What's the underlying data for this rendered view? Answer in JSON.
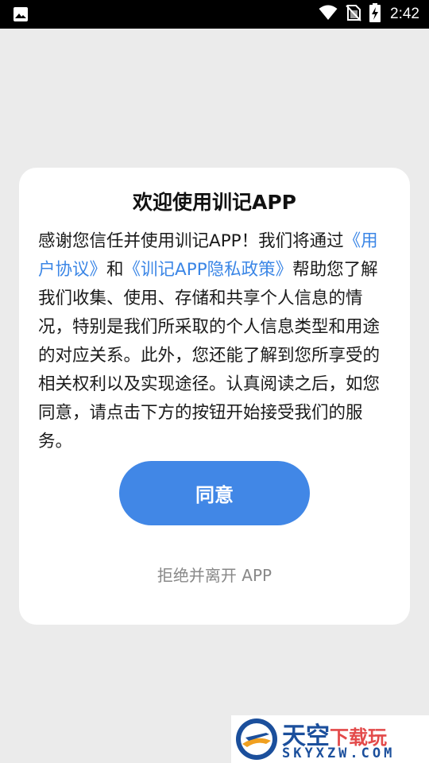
{
  "status_bar": {
    "time": "2:42",
    "icons": [
      "image-icon",
      "wifi-icon",
      "no-sim-icon",
      "battery-charging-icon"
    ]
  },
  "dialog": {
    "title": "欢迎使用训记APP",
    "body_text_1": "感谢您信任并使用训记APP！我们将通过",
    "link_user_agreement": "《用户协议》",
    "body_text_and": "和",
    "link_privacy_policy": "《训记APP隐私政策》",
    "body_text_2": "帮助您了解我们收集、使用、存储和共享个人信息的情况，特别是我们所采取的个人信息类型和用途的对应关系。此外，您还能了解到您所享受的相关权利以及实现途径。认真阅读之后，如您同意，请点击下方的按钮开始接受我们的服务。",
    "agree_label": "同意",
    "reject_label": "拒绝并离开 APP",
    "accent_color": "#4187e6",
    "link_color": "#3b86e6"
  },
  "watermark": {
    "name_main": "天空",
    "name_accent": "下载玩",
    "domain": "SKYXZW.COM"
  }
}
